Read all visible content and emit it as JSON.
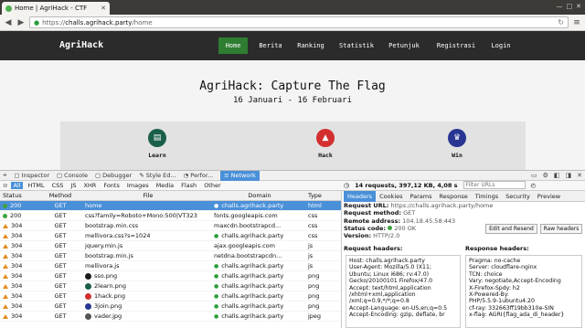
{
  "browser": {
    "tab_title": "Home | AgriHack - CTF",
    "url_prefix": "https://",
    "url_host": "challs.agrihack.party",
    "url_path": "/home"
  },
  "site": {
    "logo": "AgriHack",
    "nav": [
      "Home",
      "Berita",
      "Ranking",
      "Statistik",
      "Petunjuk",
      "Registrasi",
      "Login"
    ],
    "title": "AgriHack: Capture The Flag",
    "subtitle": "16 Januari - 16 Februari",
    "features": [
      {
        "label": "Learn",
        "color": "#1b5e4a"
      },
      {
        "label": "Hack",
        "color": "#d32f2f"
      },
      {
        "label": "Win",
        "color": "#283593"
      }
    ]
  },
  "devtools": {
    "tabs": [
      "Inspector",
      "Console",
      "Debugger",
      "Style Ed...",
      "Perfor...",
      "Network"
    ],
    "filters": [
      "All",
      "HTML",
      "CSS",
      "JS",
      "XHR",
      "Fonts",
      "Images",
      "Media",
      "Flash",
      "Other"
    ],
    "summary": "14 requests, 397,12 KB, 4,08 s",
    "filter_placeholder": "Filter URLs",
    "columns": [
      "Status",
      "Method",
      "File",
      "Domain",
      "Type"
    ],
    "rows": [
      {
        "status": "200",
        "method": "GET",
        "file": "home",
        "domain": "challs.agrihack.party",
        "type": "html"
      },
      {
        "status": "200",
        "method": "GET",
        "file": "css?family=Roboto+Mono:500|VT323",
        "domain": "fonts.googleapis.com",
        "type": "css"
      },
      {
        "status": "304",
        "method": "GET",
        "file": "bootstrap.min.css",
        "domain": "maxcdn.bootstrapcd...",
        "type": "css"
      },
      {
        "status": "304",
        "method": "GET",
        "file": "mellivora.css?s=1024",
        "domain": "challs.agrihack.party",
        "type": "css"
      },
      {
        "status": "304",
        "method": "GET",
        "file": "jquery.min.js",
        "domain": "ajax.googleapis.com",
        "type": "js"
      },
      {
        "status": "304",
        "method": "GET",
        "file": "bootstrap.min.js",
        "domain": "netdna.bootstrapcdn...",
        "type": "js"
      },
      {
        "status": "304",
        "method": "GET",
        "file": "mellivora.js",
        "domain": "challs.agrihack.party",
        "type": "js"
      },
      {
        "status": "304",
        "method": "GET",
        "file": "sso.png",
        "domain": "challs.agrihack.party",
        "type": "png"
      },
      {
        "status": "304",
        "method": "GET",
        "file": "2learn.png",
        "domain": "challs.agrihack.party",
        "type": "png"
      },
      {
        "status": "304",
        "method": "GET",
        "file": "1hack.png",
        "domain": "challs.agrihack.party",
        "type": "png"
      },
      {
        "status": "304",
        "method": "GET",
        "file": "3join.png",
        "domain": "challs.agrihack.party",
        "type": "png"
      },
      {
        "status": "304",
        "method": "GET",
        "file": "vader.jpg",
        "domain": "challs.agrihack.party",
        "type": "jpeg"
      }
    ],
    "detail_tabs": [
      "Headers",
      "Cookies",
      "Params",
      "Response",
      "Timings",
      "Security",
      "Preview"
    ],
    "request_url_label": "Request URL:",
    "request_url": "https://challs.agrihack.party/home",
    "request_method_label": "Request method:",
    "request_method": "GET",
    "remote_address_label": "Remote address:",
    "remote_address": "104.18.45.58:443",
    "status_code_label": "Status code:",
    "status_code": "200 OK",
    "version_label": "Version:",
    "version": "HTTP/2.0",
    "edit_resend": "Edit and Resend",
    "raw_headers": "Raw headers",
    "request_headers_title": "Request headers:",
    "response_headers_title": "Response headers:",
    "request_headers": [
      "Host: challs.agrihack.party",
      "User-Agent: Mozilla/5.0 (X11;",
      "Ubuntu; Linux i686; rv:47.0)",
      "Gecko/20100101 Firefox/47.0",
      "Accept: text/html,application",
      "/xhtml+xml,application",
      "/xml;q=0.9,*/*;q=0.8",
      "Accept-Language: en-US,en;q=0.5",
      "Accept-Encoding: gzip, deflate, br"
    ],
    "response_headers": [
      "Pragma: no-cache",
      "Server: cloudflare-nginx",
      "TCN: choice",
      "Vary: negotiate,Accept-Encoding",
      "X-Firefox-Spdy: h2",
      "X-Powered-By:",
      "PHP/5.5.9-1ubuntu4.20",
      "cf-ray: 332663ff19bb310e-SIN",
      "x-flag: AGRI{flag_ada_di_header}"
    ]
  }
}
